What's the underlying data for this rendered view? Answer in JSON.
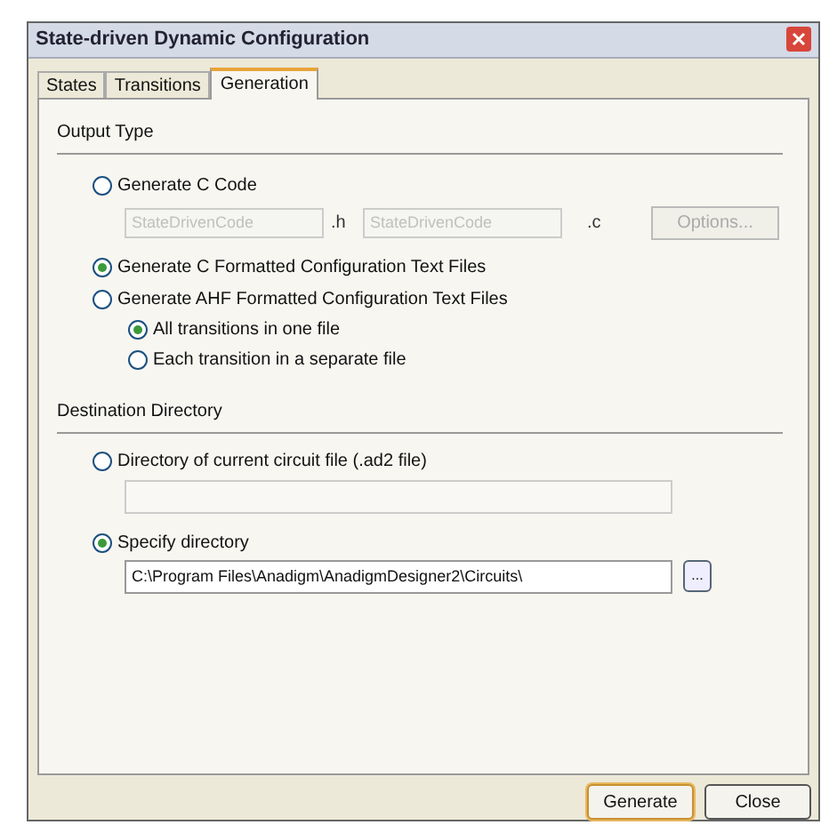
{
  "window": {
    "title": "State-driven Dynamic Configuration"
  },
  "tabs": [
    {
      "label": "States",
      "selected": false
    },
    {
      "label": "Transitions",
      "selected": false
    },
    {
      "label": "Generation",
      "selected": true
    }
  ],
  "output_type": {
    "heading": "Output Type",
    "c_code": {
      "label": "Generate C Code",
      "selected": false,
      "header_field": {
        "value": "StateDrivenCode",
        "disabled": true
      },
      "header_ext": ".h",
      "source_field": {
        "value": "StateDrivenCode",
        "disabled": true
      },
      "source_ext": ".c",
      "options_button": {
        "label": "Options...",
        "disabled": true
      }
    },
    "c_text": {
      "label": "Generate C Formatted Configuration Text Files",
      "selected": true
    },
    "ahf_text": {
      "label": "Generate AHF Formatted Configuration Text Files",
      "selected": false,
      "sub_options": [
        {
          "label": "All transitions in one file",
          "selected": true
        },
        {
          "label": "Each transition in a separate file",
          "selected": false
        }
      ]
    }
  },
  "destination": {
    "heading": "Destination Directory",
    "current": {
      "label": "Directory of current circuit file (.ad2 file)",
      "selected": false,
      "field": {
        "disabled": true
      }
    },
    "specify": {
      "label": "Specify directory",
      "selected": true,
      "field": {
        "value": "C:\\Program Files\\Anadigm\\AnadigmDesigner2\\Circuits\\",
        "disabled": false
      },
      "browse_button": "..."
    }
  },
  "buttons": [
    {
      "label": "Generate",
      "default": true
    },
    {
      "label": "Close",
      "default": false
    }
  ]
}
